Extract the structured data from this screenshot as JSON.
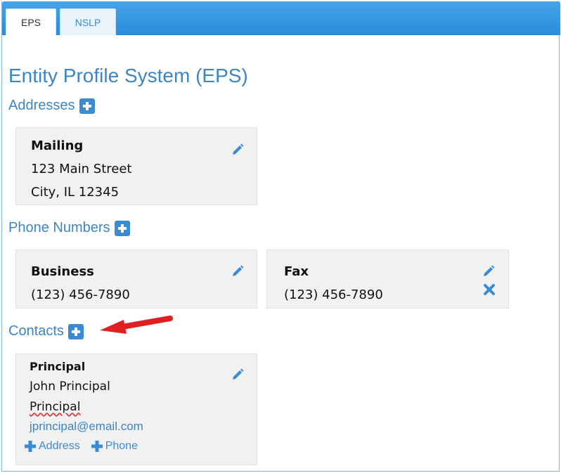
{
  "tabs": [
    {
      "label": "EPS",
      "active": true
    },
    {
      "label": "NSLP",
      "active": false
    }
  ],
  "page_title": "Entity Profile System (EPS)",
  "addresses": {
    "heading": "Addresses",
    "cards": [
      {
        "title": "Mailing",
        "line1": "123 Main Street",
        "line2": "City, IL 12345"
      }
    ]
  },
  "phone_numbers": {
    "heading": "Phone Numbers",
    "cards": [
      {
        "title": "Business",
        "number": "(123) 456-7890"
      },
      {
        "title": "Fax",
        "number": "(123) 456-7890"
      }
    ]
  },
  "contacts": {
    "heading": "Contacts",
    "cards": [
      {
        "title": "Principal",
        "name": "John Principal",
        "role": "Principal",
        "email": "jprincipal@email.com",
        "links": {
          "address": "Address",
          "phone": "Phone"
        }
      }
    ]
  },
  "colors": {
    "accent": "#3a8bd3",
    "heading": "#3b85c5",
    "tabbar": "#2a8ddb",
    "card_bg": "#f1f1f1",
    "annotation_arrow": "#e02020"
  },
  "icons": [
    "plus-icon",
    "pencil-icon",
    "close-icon",
    "arrow-icon"
  ]
}
